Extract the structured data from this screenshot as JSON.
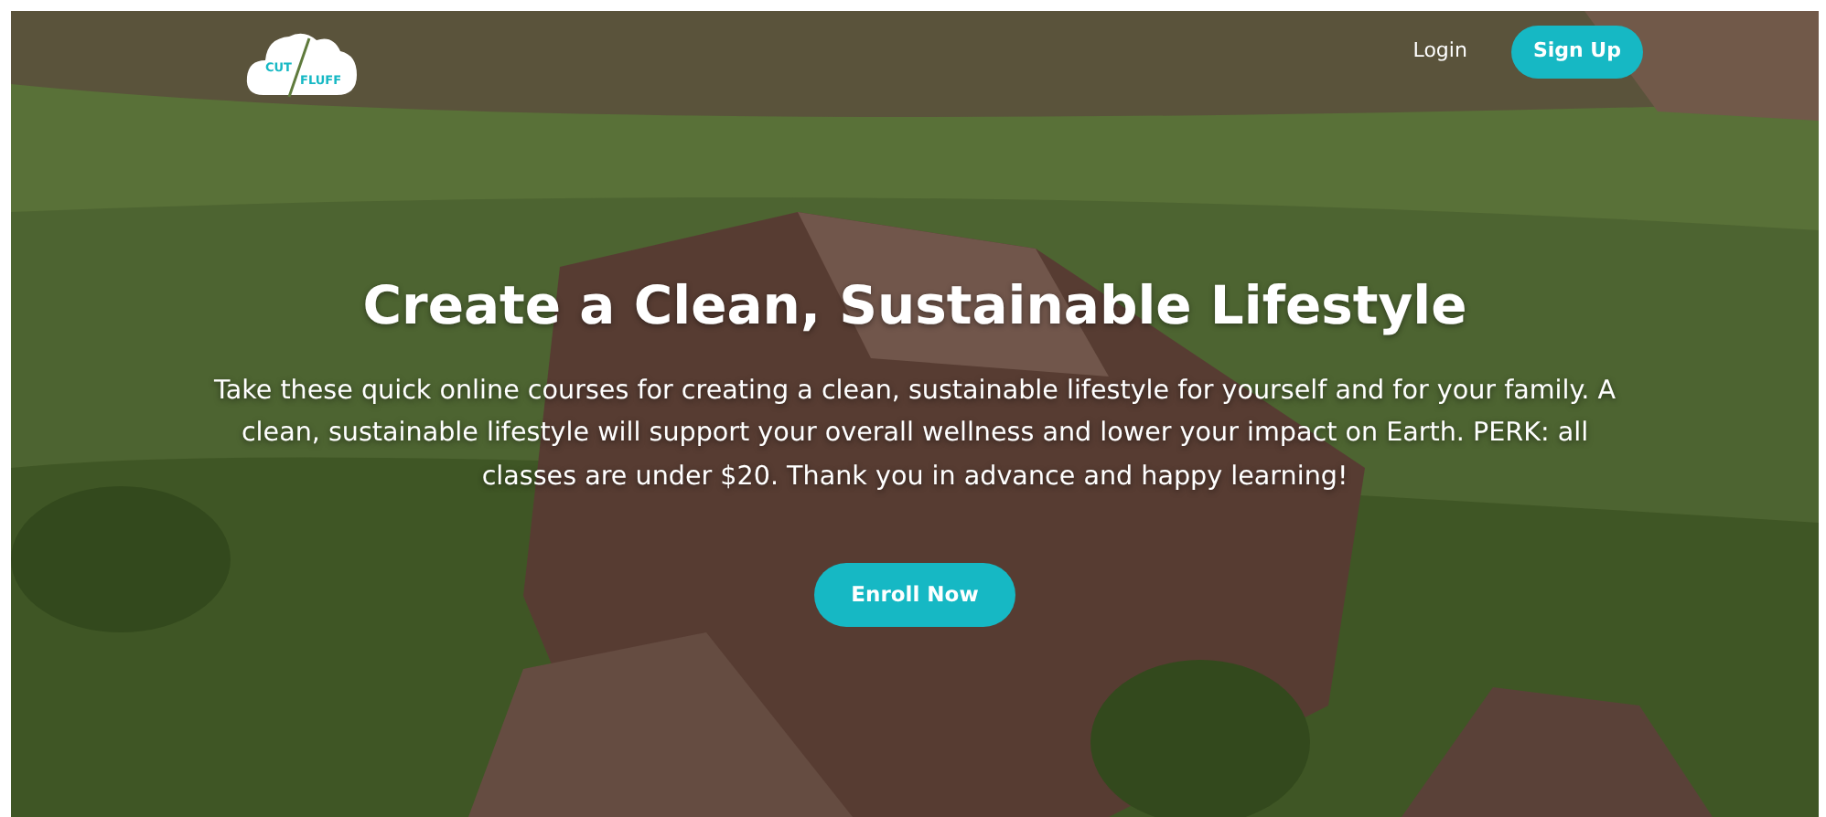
{
  "logo": {
    "left_word": "CUT",
    "right_word": "FLUFF"
  },
  "nav": {
    "links": [
      {
        "label": "Login",
        "kind": "link"
      },
      {
        "label": "Sign Up",
        "kind": "button"
      }
    ]
  },
  "hero": {
    "title": "Create a Clean, Sustainable Lifestyle",
    "text": "Take these quick online courses for creating a clean, sustainable lifestyle for yourself and for your family. A clean, sustainable lifestyle will support your overall wellness and lower your impact on Earth. PERK: all classes are under $20. Thank you in advance and happy learning!",
    "button": "Enroll Now"
  }
}
